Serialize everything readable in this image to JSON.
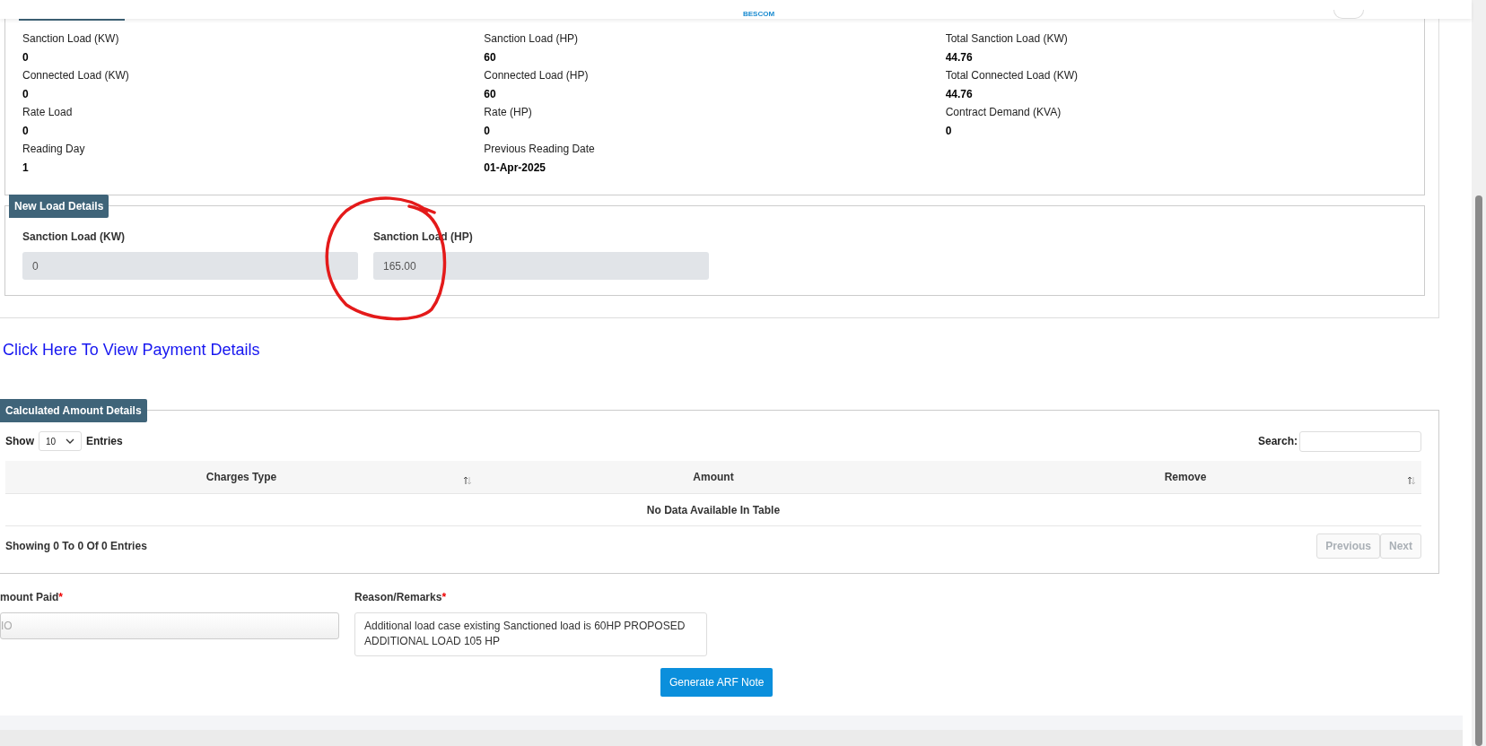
{
  "header": {
    "logo_text": "BESCOM"
  },
  "existing_load": {
    "columns": [
      [
        {
          "label": "Sanction Load (KW)",
          "value": "0"
        },
        {
          "label": "Connected Load (KW)",
          "value": "0"
        },
        {
          "label": "Rate Load",
          "value": "0"
        },
        {
          "label": "Reading Day",
          "value": "1"
        }
      ],
      [
        {
          "label": "Sanction Load (HP)",
          "value": "60"
        },
        {
          "label": "Connected Load (HP)",
          "value": "60"
        },
        {
          "label": "Rate (HP)",
          "value": "0"
        },
        {
          "label": "Previous Reading Date",
          "value": "01-Apr-2025"
        }
      ],
      [
        {
          "label": "Total Sanction Load (KW)",
          "value": "44.76"
        },
        {
          "label": "Total Connected Load (KW)",
          "value": "44.76"
        },
        {
          "label": "Contract Demand (KVA)",
          "value": "0"
        }
      ]
    ]
  },
  "new_load": {
    "title": "New Load Details",
    "fields": [
      {
        "label": "Sanction Load (KW)",
        "value": "0",
        "circled": false
      },
      {
        "label": "Sanction Load (HP)",
        "value": "165.00",
        "circled": true
      }
    ]
  },
  "payment_link": "Click Here To View Payment Details",
  "calculated_amount": {
    "title": "Calculated Amount Details",
    "show_label": "Show",
    "page_size": "10",
    "entries_label": "Entries",
    "search_label": "Search:",
    "table": {
      "columns": [
        {
          "label": "Charges Type",
          "sortable": true
        },
        {
          "label": "Amount",
          "sortable": false
        },
        {
          "label": "Remove",
          "sortable": true
        }
      ],
      "empty_text": "No Data Available In Table"
    },
    "info": "Showing 0 To 0 Of 0 Entries",
    "pagination": [
      {
        "label": "Previous",
        "disabled": true
      },
      {
        "label": "Next",
        "disabled": true
      }
    ]
  },
  "form": {
    "amount_paid": {
      "label": "mount Paid",
      "required": true,
      "required_mark": "*",
      "placeholder": "IO"
    },
    "remarks": {
      "label": "Reason/Remarks",
      "required": true,
      "required_mark": "*",
      "value": "Additional load case existing Sanctioned load is 60HP PROPOSED ADDITIONAL LOAD 105 HP"
    },
    "submit": "Generate ARF Note"
  }
}
